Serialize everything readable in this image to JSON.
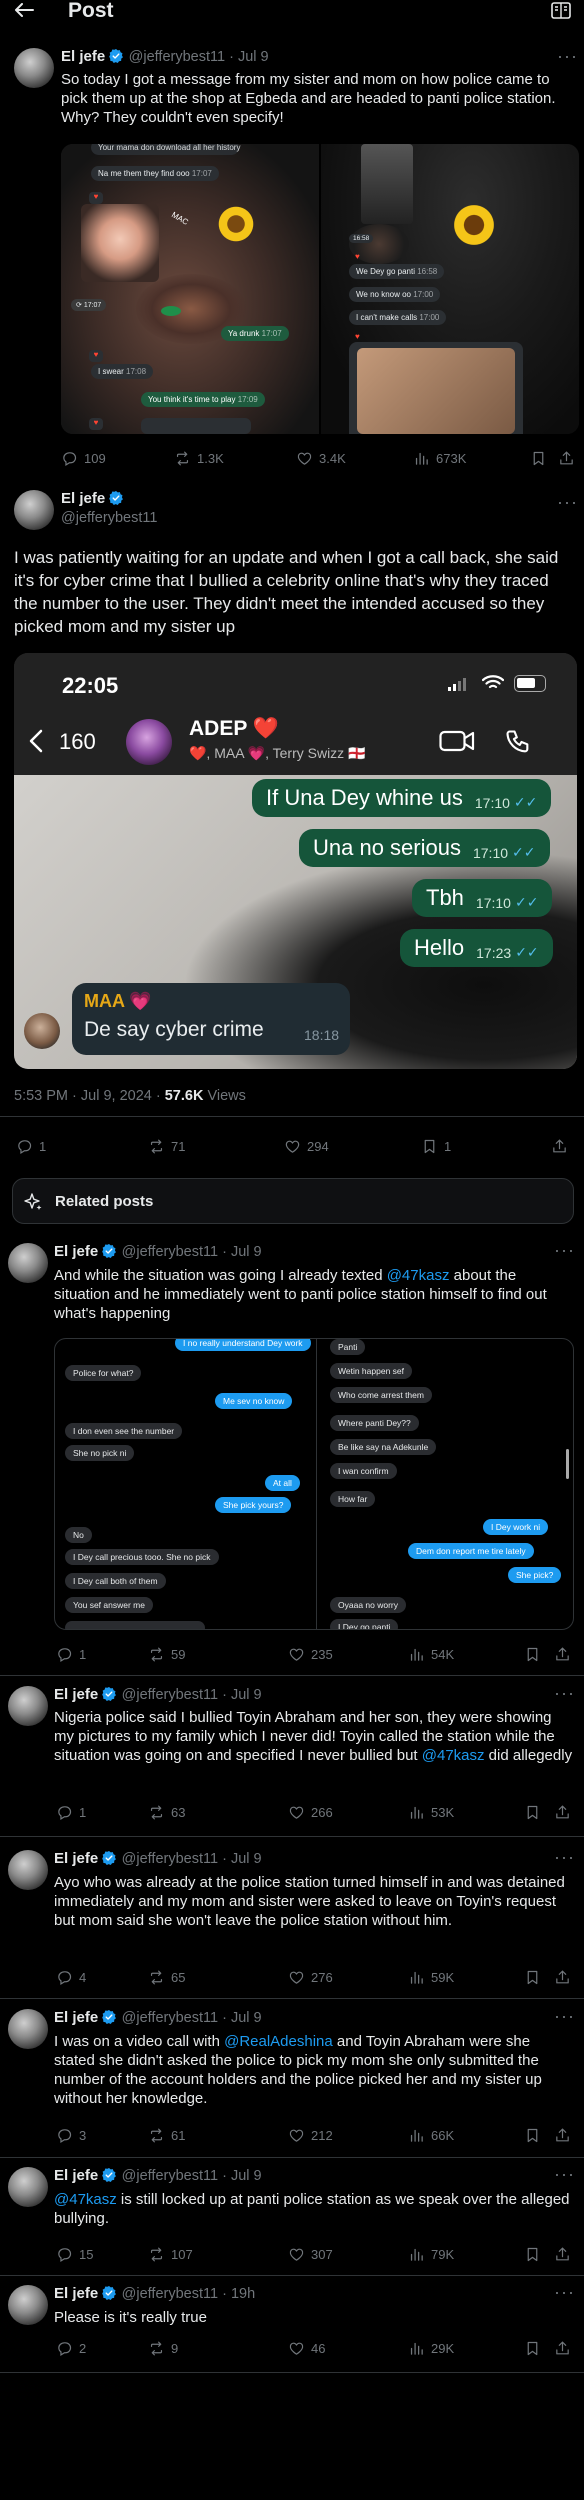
{
  "header": {
    "title": "Post"
  },
  "main_post": {
    "author": "El jefe",
    "handle": "@jefferybest11",
    "date": "Jul 9",
    "text": "So today I got a message from my sister and mom on how police came to pick them up at the shop at Egbeda and are headed to panti police station. Why? They couldn't even specify!",
    "stats": {
      "replies": "109",
      "reposts": "1.3K",
      "likes": "3.4K",
      "views": "673K"
    },
    "left_image_messages": [
      "Your mama don download all her history",
      "Na me them they find ooo",
      "I swear",
      "You think it's time to play",
      "Ya drunk"
    ],
    "left_times": [
      "17:04",
      "17:07",
      "17:07",
      "17:08",
      "17:09",
      "17:07"
    ],
    "right_image_messages": [
      "We Dey go panti",
      "We no know oo",
      "I can't make calls"
    ],
    "right_times": [
      "16:58",
      "16:58",
      "17:00",
      "17:00"
    ],
    "sticker_text": "MAC"
  },
  "second_post": {
    "author": "El jefe",
    "handle": "@jefferybest11",
    "text": "I was patiently waiting for an update and when I got a call back, she said it's for cyber crime that I bullied a celebrity online that's why they traced the number to the user. They didn't meet the intended accused so they picked mom and my sister up",
    "phone": {
      "time": "22:05",
      "back_count": "160",
      "chat_name": "ADEP ❤️",
      "chat_members": "❤️, MAA 💗, Terry Swizz 🏴󠁧󠁢󠁥󠁮󠁧󠁿",
      "messages": [
        {
          "text": "If Una Dey whine us",
          "time": "17:10"
        },
        {
          "text": "Una no serious",
          "time": "17:10"
        },
        {
          "text": "Tbh",
          "time": "17:10"
        },
        {
          "text": "Hello",
          "time": "17:23"
        }
      ],
      "incoming_sender": "MAA 💗",
      "incoming_text": "De say cyber crime",
      "incoming_time": "18:18"
    },
    "timestamp": "5:53 PM · Jul 9, 2024 · ",
    "views_count": "57.6K",
    "views_label": " Views",
    "stats": {
      "replies": "1",
      "reposts": "71",
      "likes": "294",
      "bookmarks": "1"
    }
  },
  "related": {
    "label": "Related posts"
  },
  "replies": [
    {
      "author": "El jefe",
      "handle": "@jefferybest11",
      "date": "Jul 9",
      "text_before": "And while the situation was going I already texted ",
      "mention": "@47kasz",
      "text_after": " about the situation and he immediately went to panti police station himself to find out what's happening",
      "stats": {
        "replies": "1",
        "reposts": "59",
        "likes": "235",
        "views": "54K"
      },
      "chat_left": [
        {
          "text": "I no really understand Dey work",
          "kind": "blue"
        },
        {
          "text": "Police for what?",
          "kind": "grey"
        },
        {
          "text": "Me sev no know",
          "kind": "blue"
        },
        {
          "text": "I don even see the number",
          "kind": "grey"
        },
        {
          "text": "She no pick ni",
          "kind": "grey"
        },
        {
          "text": "At all",
          "kind": "blue"
        },
        {
          "text": "She pick yours?",
          "kind": "blue"
        },
        {
          "text": "No",
          "kind": "grey"
        },
        {
          "text": "I Dey call precious tooo. She no pick",
          "kind": "grey"
        },
        {
          "text": "I Dey call both of them",
          "kind": "grey"
        },
        {
          "text": "You sef answer me",
          "kind": "grey"
        }
      ],
      "chat_right": [
        {
          "text": "Panti",
          "kind": "grey"
        },
        {
          "text": "Wetin happen sef",
          "kind": "grey"
        },
        {
          "text": "Who come arrest them",
          "kind": "grey"
        },
        {
          "text": "Where panti Dey??",
          "kind": "grey"
        },
        {
          "text": "Be like say na Adekunle",
          "kind": "grey"
        },
        {
          "text": "I wan confirm",
          "kind": "grey"
        },
        {
          "text": "How far",
          "kind": "grey"
        },
        {
          "text": "I Dey work ni",
          "kind": "blue"
        },
        {
          "text": "Dem don report me tire lately",
          "kind": "blue"
        },
        {
          "text": "She pick?",
          "kind": "blue"
        },
        {
          "text": "Oyaaa no worry",
          "kind": "grey"
        },
        {
          "text": "I Dey go panti",
          "kind": "grey"
        }
      ]
    },
    {
      "author": "El jefe",
      "handle": "@jefferybest11",
      "date": "Jul 9",
      "text_before": "Nigeria police said I bullied Toyin Abraham and her son, they were showing my pictures to my family which I never did! Toyin called the station while the situation was going on and specified I never bullied but ",
      "mention": "@47kasz",
      "text_after": " did allegedly",
      "stats": {
        "replies": "1",
        "reposts": "63",
        "likes": "266",
        "views": "53K"
      }
    },
    {
      "author": "El jefe",
      "handle": "@jefferybest11",
      "date": "Jul 9",
      "text_before": "Ayo who was already at the police station turned himself in and was detained immediately and my mom and sister were asked to leave on Toyin's request but mom said she won't leave the police station without him.",
      "mention": "",
      "text_after": "",
      "stats": {
        "replies": "4",
        "reposts": "65",
        "likes": "276",
        "views": "59K"
      }
    },
    {
      "author": "El jefe",
      "handle": "@jefferybest11",
      "date": "Jul 9",
      "text_before": "I was on a video call with ",
      "mention": "@RealAdeshina",
      "text_after": " and Toyin Abraham were she stated she didn't asked the police to pick my mom she only submitted the number of the account holders and the police picked her and my sister up without her knowledge.",
      "stats": {
        "replies": "3",
        "reposts": "61",
        "likes": "212",
        "views": "66K"
      }
    },
    {
      "author": "El jefe",
      "handle": "@jefferybest11",
      "date": "Jul 9",
      "text_before": "",
      "mention": "@47kasz",
      "text_after": " is still locked up at panti police station as we speak over the alleged bullying.",
      "stats": {
        "replies": "15",
        "reposts": "107",
        "likes": "307",
        "views": "79K"
      }
    },
    {
      "author": "El jefe",
      "handle": "@jefferybest11",
      "date": "19h",
      "text_before": "Please is it's really true",
      "mention": "",
      "text_after": "",
      "stats": {
        "replies": "2",
        "reposts": "9",
        "likes": "46",
        "views": "29K"
      }
    }
  ]
}
